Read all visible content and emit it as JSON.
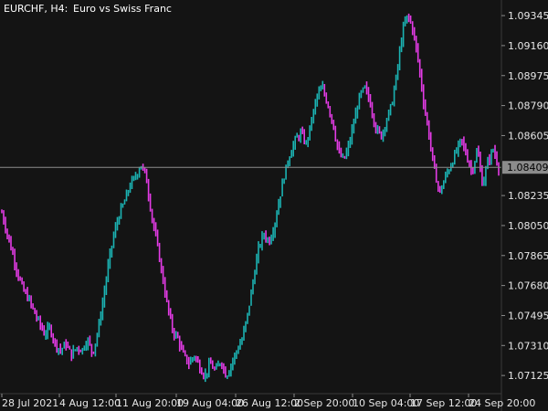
{
  "title": {
    "symbol_timeframe": "EURCHF, H4:",
    "description": "Euro vs Swiss Franc"
  },
  "colors": {
    "background": "#141414",
    "up": "#1bb3b3",
    "down": "#e43be6",
    "price_line": "#8c8c8c",
    "price_label_bg": "#8c8c8c",
    "price_label_text": "#000000",
    "axis_text": "#e6e6e6"
  },
  "current_price_label": "1.08409",
  "chart_data": {
    "type": "line",
    "title": "EURCHF, H4:  Euro vs Swiss Franc",
    "xlabel": "",
    "ylabel": "",
    "ylim": [
      1.0703,
      1.0943
    ],
    "y_ticks": [
      "1.09345",
      "1.09160",
      "1.08975",
      "1.08790",
      "1.08605",
      "1.08409",
      "1.08235",
      "1.08050",
      "1.07865",
      "1.07680",
      "1.07495",
      "1.07310",
      "1.07125"
    ],
    "y_tick_values": [
      1.09345,
      1.0916,
      1.08975,
      1.0879,
      1.08605,
      1.08235,
      1.0805,
      1.07865,
      1.0768,
      1.07495,
      1.0731,
      1.07125
    ],
    "x_tick_labels": [
      "28 Jul 2021",
      "4 Aug 12:00",
      "11 Aug 20:00",
      "19 Aug 04:00",
      "26 Aug 12:00",
      "2 Sep 20:00",
      "10 Sep 04:00",
      "17 Sep 12:00",
      "24 Sep 20:00"
    ],
    "current_price": 1.08409,
    "series": [
      {
        "values": [
          1.0813,
          1.08,
          1.0788,
          1.0775,
          1.0765,
          1.076,
          1.0752,
          1.0745,
          1.0738,
          1.0742,
          1.0732,
          1.0728,
          1.0732,
          1.0725,
          1.073,
          1.0728,
          1.0735,
          1.0726,
          1.074,
          1.076,
          1.0782,
          1.08,
          1.0812,
          1.082,
          1.083,
          1.0835,
          1.0843,
          1.0835,
          1.0812,
          1.0795,
          1.0775,
          1.0755,
          1.074,
          1.0735,
          1.0725,
          1.072,
          1.0725,
          1.0718,
          1.0712,
          1.072,
          1.0715,
          1.0722,
          1.0712,
          1.072,
          1.0728,
          1.0735,
          1.075,
          1.077,
          1.079,
          1.08,
          1.0795,
          1.0805,
          1.0822,
          1.0838,
          1.085,
          1.0858,
          1.0862,
          1.0855,
          1.087,
          1.0885,
          1.089,
          1.088,
          1.0868,
          1.085,
          1.0845,
          1.0855,
          1.087,
          1.0885,
          1.089,
          1.088,
          1.0865,
          1.086,
          1.087,
          1.088,
          1.09,
          1.0925,
          1.0935,
          1.0925,
          1.0905,
          1.088,
          1.086,
          1.0838,
          1.0825,
          1.0835,
          1.0842,
          1.085,
          1.0858,
          1.0848,
          1.0838,
          1.0852,
          1.083,
          1.0845,
          1.0852,
          1.0841
        ]
      }
    ]
  }
}
